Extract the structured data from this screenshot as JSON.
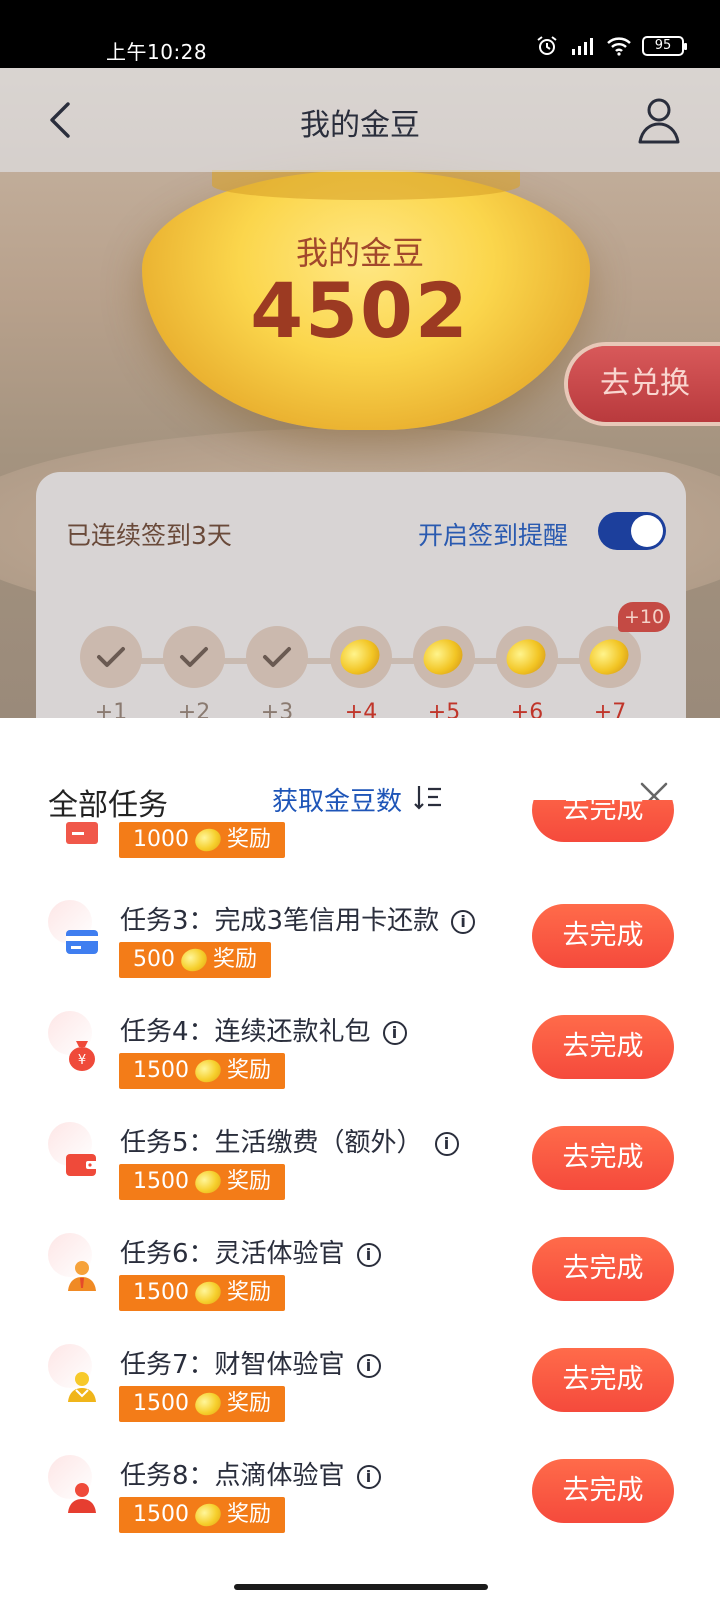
{
  "status_bar": {
    "time": "上午10:28",
    "battery": "95"
  },
  "header": {
    "title": "我的金豆"
  },
  "balance": {
    "label": "我的金豆",
    "value": "4502"
  },
  "exchange_button": "去兑换",
  "signin": {
    "streak_text": "已连续签到3天",
    "remind_label": "开启签到提醒",
    "remind_enabled": true,
    "bonus_badge": "+10",
    "days": [
      {
        "reward": "+1",
        "checked": true
      },
      {
        "reward": "+2",
        "checked": true
      },
      {
        "reward": "+3",
        "checked": true
      },
      {
        "reward": "+4",
        "checked": false
      },
      {
        "reward": "+5",
        "checked": false
      },
      {
        "reward": "+6",
        "checked": false
      },
      {
        "reward": "+7",
        "checked": false
      }
    ]
  },
  "sheet": {
    "title": "全部任务",
    "sort_label": "获取金豆数",
    "partial_task": {
      "reward_amount": "1000",
      "reward_label": "奖励",
      "button": "去完成"
    },
    "tasks": [
      {
        "title": "任务3：完成3笔信用卡还款",
        "reward_amount": "500",
        "reward_label": "奖励",
        "button": "去完成",
        "icon": "credit-card-icon"
      },
      {
        "title": "任务4：连续还款礼包",
        "reward_amount": "1500",
        "reward_label": "奖励",
        "button": "去完成",
        "icon": "money-bag-icon"
      },
      {
        "title": "任务5：生活缴费（额外）",
        "reward_amount": "1500",
        "reward_label": "奖励",
        "button": "去完成",
        "icon": "wallet-icon"
      },
      {
        "title": "任务6：灵活体验官",
        "reward_amount": "1500",
        "reward_label": "奖励",
        "button": "去完成",
        "icon": "person-tie-icon"
      },
      {
        "title": "任务7：财智体验官",
        "reward_amount": "1500",
        "reward_label": "奖励",
        "button": "去完成",
        "icon": "person-gold-icon"
      },
      {
        "title": "任务8：点滴体验官",
        "reward_amount": "1500",
        "reward_label": "奖励",
        "button": "去完成",
        "icon": "person-red-icon"
      }
    ]
  },
  "colors": {
    "accent_orange": "#f37c18",
    "button_red": "#f54a3c",
    "link_blue": "#1e55b8"
  }
}
